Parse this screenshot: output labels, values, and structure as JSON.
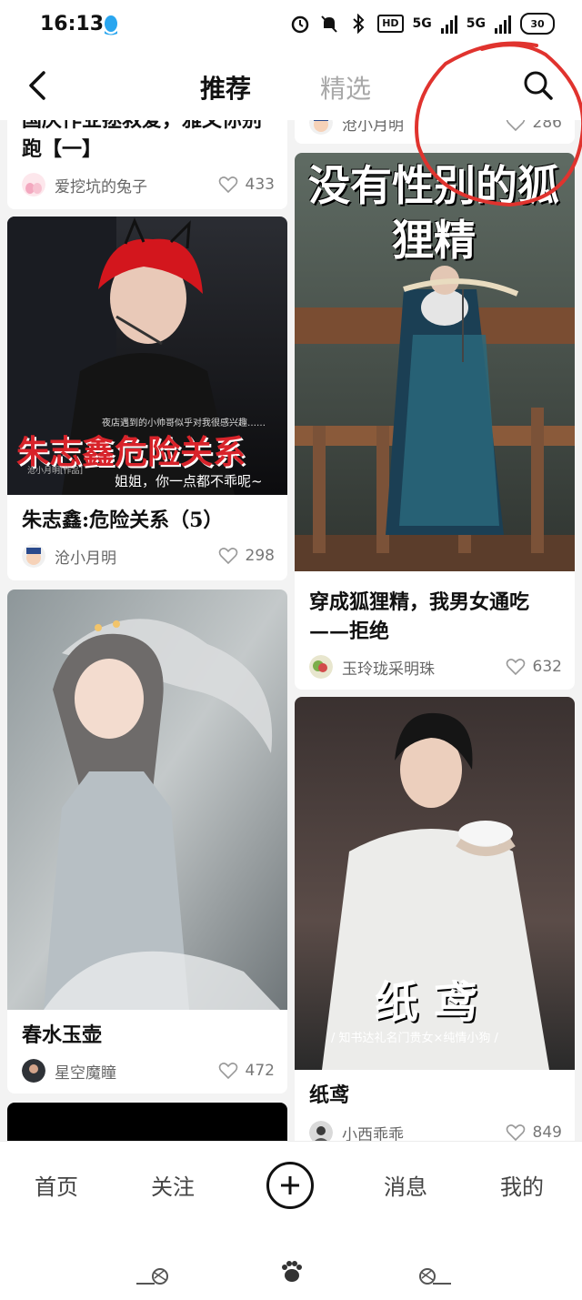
{
  "status": {
    "time": "16:13",
    "battery": "30",
    "network_a": "5G",
    "network_b": "5G",
    "hd": "HD"
  },
  "nav": {
    "tabs": [
      {
        "label": "推荐",
        "active": true
      },
      {
        "label": "精选",
        "active": false
      }
    ]
  },
  "cards": [
    {
      "title": "国庆作业拯救爱，雅文你别跑【一】",
      "author": "爱挖坑的兔子",
      "likes": "433"
    },
    {
      "cover_headline": "朱志鑫危险关系",
      "cover_tagline": "夜店遇到的小帅哥似乎对我很感兴趣……",
      "cover_subtitle": "姐姐，你一点都不乖呢~",
      "cover_credit": "沧小月明[作品]",
      "title": "朱志鑫:危险关系（5）",
      "author": "沧小月明",
      "likes": "298"
    },
    {
      "title": "春水玉壶",
      "author": "星空魔瞳",
      "likes": "472"
    },
    {
      "author": "沧小月明",
      "likes": "286"
    },
    {
      "cover_headline": "没有性别的狐狸精",
      "title": "穿成狐狸精，我男女通吃——拒绝",
      "author": "玉玲珑采明珠",
      "likes": "632"
    },
    {
      "cover_headline": "纸 鸢",
      "cover_tagline": "/ 知书达礼名门贵女×纯情小狗 /",
      "title": "纸鸢",
      "author": "小西乖乖",
      "likes": "849"
    }
  ],
  "bottom_nav": {
    "home": "首页",
    "follow": "关注",
    "messages": "消息",
    "mine": "我的"
  },
  "colors": {
    "annotation": "#e0332e",
    "active_tab": "#111111",
    "inactive_tab": "#a8a8a8"
  }
}
